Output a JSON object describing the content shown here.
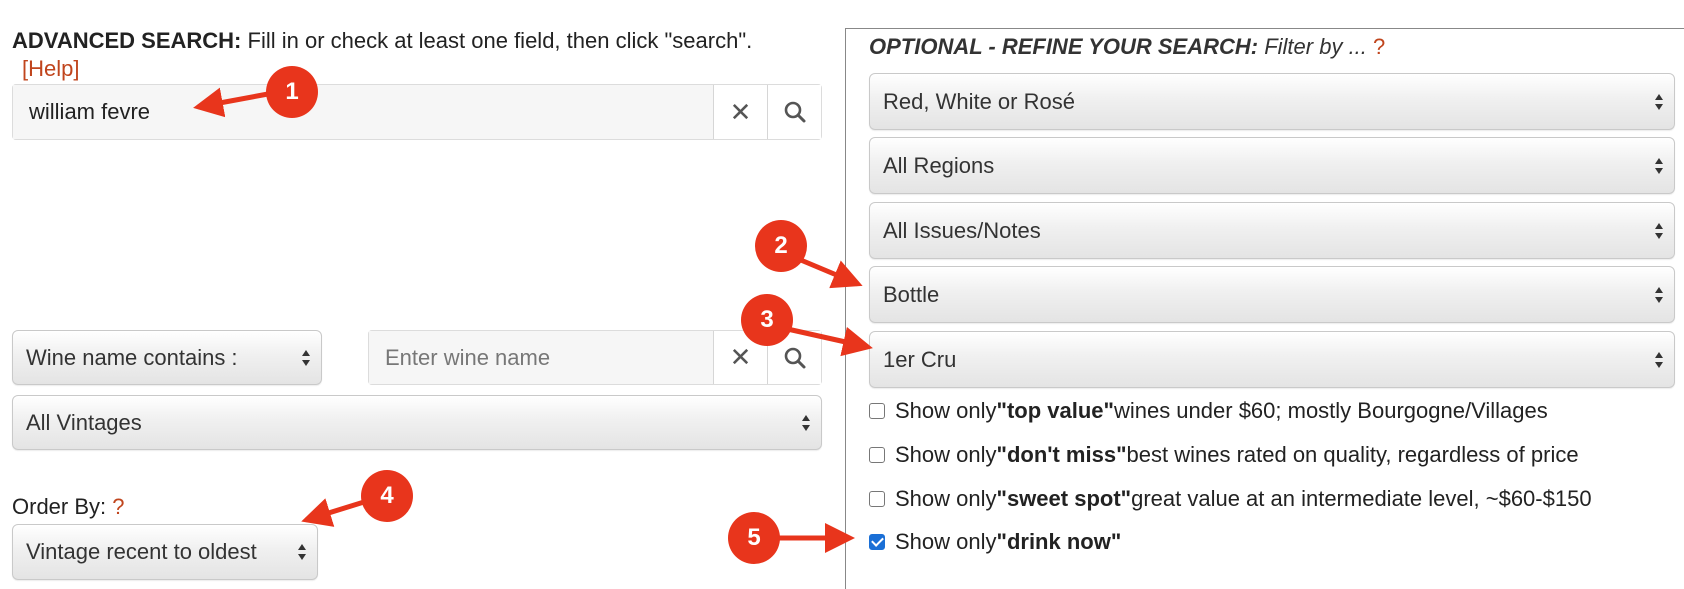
{
  "left": {
    "heading_bold": "ADVANCED SEARCH:",
    "heading_rest": " Fill in or check at least one field, then click \"search\".",
    "help_link": "[Help]",
    "main_search": {
      "value": "william fevre"
    },
    "wine_name_mode": "Wine name contains :",
    "wine_name_search": {
      "placeholder": "Enter wine name"
    },
    "vintages": "All Vintages",
    "order_by_label": "Order By:",
    "order_by_help": "?",
    "order_by_value": "Vintage recent to oldest"
  },
  "right": {
    "heading_bold": "OPTIONAL - REFINE YOUR SEARCH:",
    "heading_rest": " Filter by ... ",
    "heading_help": "?",
    "filters": {
      "color": "Red, White or Rosé",
      "region": "All Regions",
      "issues": "All Issues/Notes",
      "format": "Bottle",
      "classification": "1er Cru"
    },
    "checkboxes": [
      {
        "prefix": "Show only ",
        "bold": "\"top value\"",
        "suffix": " wines under $60; mostly Bourgogne/Villages",
        "checked": false
      },
      {
        "prefix": "Show only ",
        "bold": "\"don't miss\"",
        "suffix": " best wines rated on quality, regardless of price",
        "checked": false
      },
      {
        "prefix": "Show only ",
        "bold": "\"sweet spot\"",
        "suffix": " great value at an intermediate level, ~$60-$150",
        "checked": false
      },
      {
        "prefix": "Show only ",
        "bold": "\"drink now\"",
        "suffix": "",
        "checked": true
      }
    ]
  },
  "markers": [
    "1",
    "2",
    "3",
    "4",
    "5"
  ],
  "colors": {
    "accent_red": "#e8351c",
    "link": "#c0451d",
    "checkbox": "#1a6fd6"
  },
  "icons": {
    "clear": "close-icon",
    "search": "search-icon",
    "select": "select-arrows-icon"
  }
}
